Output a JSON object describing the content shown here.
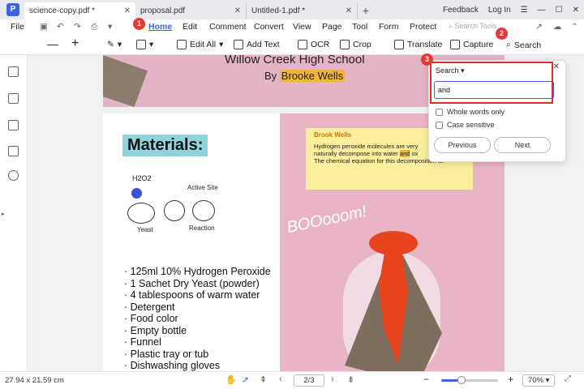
{
  "tabs": [
    {
      "label": "science-copy.pdf *"
    },
    {
      "label": "proposal.pdf"
    },
    {
      "label": "Untitled-1.pdf *"
    }
  ],
  "header": {
    "feedback": "Feedback",
    "login": "Log In"
  },
  "menu": {
    "file": "File",
    "home": "Home",
    "edit": "Edit",
    "comment": "Comment",
    "convert": "Convert",
    "view": "View",
    "page": "Page",
    "tool": "Tool",
    "form": "Form",
    "protect": "Protect",
    "search_tools": "Search Tools"
  },
  "toolbar": {
    "edit_all": "Edit All",
    "add_text": "Add Text",
    "ocr": "OCR",
    "crop": "Crop",
    "translate": "Translate",
    "capture": "Capture",
    "search": "Search"
  },
  "doc": {
    "title": "Willow Creek High School",
    "byline_prefix": "By",
    "author": "Brooke Wells",
    "materials": "Materials:",
    "h2o2": "H2O2",
    "active_site": "Active Site",
    "yeast": "Yeast",
    "reaction": "Reaction",
    "list": [
      "· 125ml 10% Hydrogen Peroxide",
      "· 1 Sachet Dry Yeast (powder)",
      "· 4 tablespoons of warm water",
      "· Detergent",
      "· Food color",
      "· Empty bottle",
      "· Funnel",
      "· Plastic tray or tub",
      "· Dishwashing gloves"
    ],
    "note_title": "Brook Wells",
    "note_l1": "Hydrogen peroxide molecules are very",
    "note_l2a": "naturally decompose into water",
    "note_hl": "and",
    "note_l2b": "ox",
    "note_l3": "The chemical equation for this decomposition is:",
    "boom": "BOOooom!"
  },
  "search_panel": {
    "mode": "Search",
    "query": "and",
    "whole_words": "Whole words only",
    "case_sensitive": "Case sensitive",
    "previous": "Previous",
    "next": "Next"
  },
  "status": {
    "dimensions": "27.94 x 21.59 cm",
    "page": "2/3",
    "zoom": "70%"
  },
  "badges": [
    "1",
    "2",
    "3"
  ],
  "colors": {
    "accent": "#3b63e6",
    "callout": "#d32f2f",
    "highlight": "#f2b33d"
  }
}
